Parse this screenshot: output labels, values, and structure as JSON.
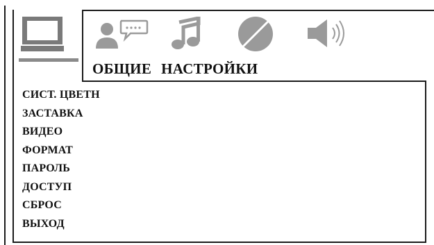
{
  "tabs": [
    {
      "name": "general",
      "icon": "monitor-icon",
      "active": true
    },
    {
      "name": "language",
      "icon": "speech-bubble-person-icon",
      "active": false
    },
    {
      "name": "audio",
      "icon": "music-note-icon",
      "active": false
    },
    {
      "name": "video",
      "icon": "contrast-disc-icon",
      "active": false
    },
    {
      "name": "speaker",
      "icon": "speaker-icon",
      "active": false
    }
  ],
  "header": {
    "title_part1": "ОБЩИЕ",
    "title_part2": "НАСТРОЙКИ"
  },
  "menu": {
    "items": [
      "СИСТ. ЦВЕТН",
      "ЗАСТАВКА",
      "ВИДЕО",
      "ФОРМАТ",
      "ПАРОЛЬ",
      "ДОСТУП",
      "СБРОС",
      "ВЫХОД"
    ]
  },
  "colors": {
    "line": "#1a1a1a",
    "active_underline": "#8a8a8a",
    "inactive_icon": "#9a9a9a",
    "active_icon": "#7a7a7a"
  }
}
